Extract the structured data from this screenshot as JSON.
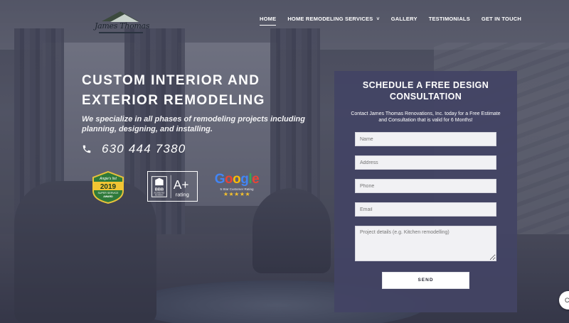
{
  "brand": {
    "logo_text": "James Thomas"
  },
  "nav": {
    "home": "HOME",
    "services": "HOME REMODELING SERVICES",
    "gallery": "GALLERY",
    "testimonials": "TESTIMONIALS",
    "contact": "GET IN TOUCH"
  },
  "hero": {
    "title": "CUSTOM INTERIOR AND EXTERIOR REMODELING",
    "subtitle": "We specialize in all phases of remodeling projects including planning, designing, and installing.",
    "phone": "630 444 7380"
  },
  "badges": {
    "angie": {
      "line1": "Angie's list",
      "year": "2019",
      "line2": "SUPER SERVICE",
      "line3": "AWARD"
    },
    "bbb": {
      "grade": "A+",
      "label": "rating",
      "acc1": "ACCREDITED",
      "acc2": "BUSINESS"
    },
    "google": {
      "letters": [
        "G",
        "o",
        "o",
        "g",
        "l",
        "e"
      ],
      "caption": "5 Star Customer Rating",
      "stars": "★★★★★"
    }
  },
  "form": {
    "title": "SCHEDULE A FREE DESIGN CONSULTATION",
    "description": "Contact James Thomas Renovations, Inc. today for a Free Estimate and Consultation that is valid for 6 Months!",
    "name_placeholder": "Name",
    "address_placeholder": "Address",
    "phone_placeholder": "Phone",
    "email_placeholder": "Email",
    "details_placeholder": "Project details (e.g. Kitchen remodelling)",
    "send_label": "SEND"
  },
  "chat": {
    "glyph": "C"
  },
  "colors": {
    "panel": "#434464",
    "accent_gold": "#f6c12b",
    "text": "#ffffff"
  }
}
